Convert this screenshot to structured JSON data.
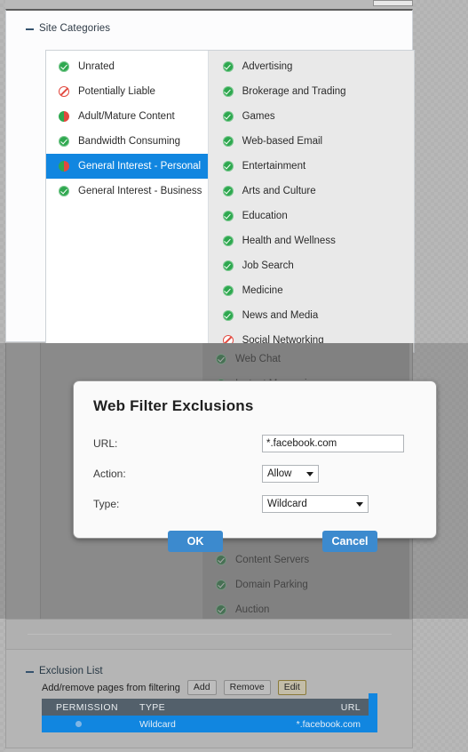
{
  "colors": {
    "accent_blue": "#1186e0",
    "button_blue": "#3c8ace",
    "allow_green": "#2ea84f",
    "block_red": "#e2493f",
    "table_header": "#53606b"
  },
  "site_categories": {
    "header": "Site Categories",
    "collapse_icon": "minus-icon",
    "left_column": [
      {
        "label": "Unrated",
        "status": "allow",
        "selected": false
      },
      {
        "label": "Potentially Liable",
        "status": "block",
        "selected": false
      },
      {
        "label": "Adult/Mature Content",
        "status": "monitor",
        "selected": false
      },
      {
        "label": "Bandwidth Consuming",
        "status": "allow",
        "selected": false
      },
      {
        "label": "General Interest - Personal",
        "status": "monitor",
        "selected": true
      },
      {
        "label": "General Interest - Business",
        "status": "allow",
        "selected": false
      }
    ],
    "right_column": [
      {
        "label": "Advertising",
        "status": "allow"
      },
      {
        "label": "Brokerage and Trading",
        "status": "allow"
      },
      {
        "label": "Games",
        "status": "allow"
      },
      {
        "label": "Web-based Email",
        "status": "allow"
      },
      {
        "label": "Entertainment",
        "status": "allow"
      },
      {
        "label": "Arts and Culture",
        "status": "allow"
      },
      {
        "label": "Education",
        "status": "allow"
      },
      {
        "label": "Health and Wellness",
        "status": "allow"
      },
      {
        "label": "Job Search",
        "status": "allow"
      },
      {
        "label": "Medicine",
        "status": "allow"
      },
      {
        "label": "News and Media",
        "status": "allow"
      },
      {
        "label": "Social Networking",
        "status": "block"
      }
    ],
    "right_column_dimmed": [
      {
        "label": "Web Chat",
        "status": "allow"
      },
      {
        "label": "Instant Messaging",
        "status": "allow"
      },
      {
        "label": "Content Servers",
        "status": "allow"
      },
      {
        "label": "Domain Parking",
        "status": "allow"
      },
      {
        "label": "Auction",
        "status": "allow"
      }
    ]
  },
  "dialog": {
    "title": "Web Filter Exclusions",
    "url_label": "URL:",
    "url_value": "*.facebook.com",
    "url_placeholder": "*.facebook.com",
    "action_label": "Action:",
    "action_value": "Allow",
    "type_label": "Type:",
    "type_value": "Wildcard",
    "ok_label": "OK",
    "cancel_label": "Cancel"
  },
  "exclusion_list": {
    "header": "Exclusion List",
    "collapse_icon": "minus-icon",
    "description": "Add/remove pages from filtering",
    "add_label": "Add",
    "remove_label": "Remove",
    "edit_label": "Edit",
    "columns": [
      "PERMISSION",
      "TYPE",
      "URL"
    ],
    "rows": [
      {
        "permission": "",
        "type": "Wildcard",
        "url": "*.facebook.com"
      }
    ]
  }
}
